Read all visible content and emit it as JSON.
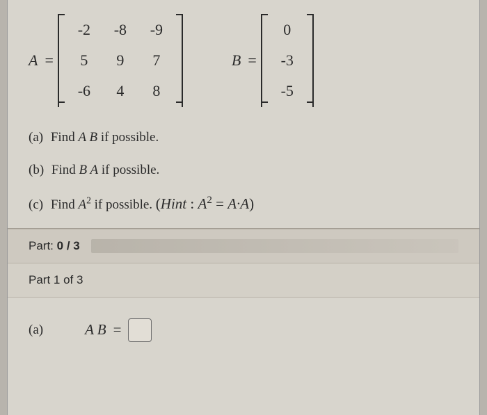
{
  "matrixA": {
    "label": "A",
    "rows": [
      [
        "-2",
        "-8",
        "-9"
      ],
      [
        "5",
        "9",
        "7"
      ],
      [
        "-6",
        "4",
        "8"
      ]
    ]
  },
  "matrixB": {
    "label": "B",
    "rows": [
      [
        "0"
      ],
      [
        "-3"
      ],
      [
        "-5"
      ]
    ]
  },
  "questions": {
    "a": {
      "label": "(a)",
      "text_pre": "Find ",
      "var": "A B",
      "text_post": " if possible."
    },
    "b": {
      "label": "(b)",
      "text_pre": "Find ",
      "var": "B A",
      "text_post": " if possible."
    },
    "c": {
      "label": "(c)",
      "text_pre": "Find ",
      "var": "A",
      "exp": "2",
      "text_post": " if possible. ",
      "hint_open": "(",
      "hint_label": "Hint",
      "hint_colon": " : ",
      "hint_lhs": "A",
      "hint_exp": "2",
      "hint_eq": " = ",
      "hint_rhs": "A·A",
      "hint_close": ")"
    }
  },
  "progress": {
    "label_prefix": "Part: ",
    "current": "0",
    "sep": " / ",
    "total": "3"
  },
  "part_header": "Part 1 of 3",
  "answer": {
    "label": "(a)",
    "expr": "A B",
    "eq": "="
  },
  "chart_data": {
    "type": "table",
    "matrices": {
      "A": [
        [
          -2,
          -8,
          -9
        ],
        [
          5,
          9,
          7
        ],
        [
          -6,
          4,
          8
        ]
      ],
      "B": [
        [
          0
        ],
        [
          -3
        ],
        [
          -5
        ]
      ]
    }
  }
}
